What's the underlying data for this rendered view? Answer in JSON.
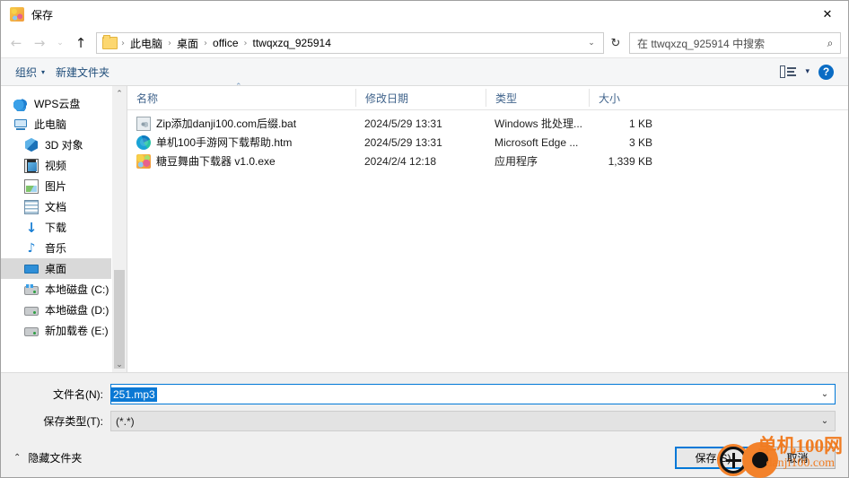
{
  "window": {
    "title": "保存",
    "icon": "app-icon",
    "close_label": "✕"
  },
  "nav": {
    "back": "←",
    "forward": "→",
    "history": "⌄",
    "up": "↑",
    "breadcrumbs": [
      "此电脑",
      "桌面",
      "office",
      "ttwqxzq_925914"
    ],
    "separator": "›",
    "dropdown": "⌄",
    "refresh": "↻",
    "search_placeholder": "在 ttwqxzq_925914 中搜索",
    "search_value": "",
    "search_icon": "⌕"
  },
  "command_bar": {
    "organize": "组织",
    "organize_caret": "▾",
    "new_folder": "新建文件夹",
    "view_caret": "▾",
    "help": "?"
  },
  "sidebar": {
    "scroll_up": "⌃",
    "scroll_down": "⌄",
    "items": [
      {
        "label": "WPS云盘",
        "icon": "cloud-icon",
        "indent": false,
        "selected": false
      },
      {
        "label": "此电脑",
        "icon": "pc-icon",
        "indent": false,
        "selected": false
      },
      {
        "label": "3D 对象",
        "icon": "3d-objects-icon",
        "indent": true,
        "selected": false
      },
      {
        "label": "视频",
        "icon": "video-icon",
        "indent": true,
        "selected": false
      },
      {
        "label": "图片",
        "icon": "pictures-icon",
        "indent": true,
        "selected": false
      },
      {
        "label": "文档",
        "icon": "documents-icon",
        "indent": true,
        "selected": false
      },
      {
        "label": "下载",
        "icon": "downloads-icon",
        "indent": true,
        "selected": false
      },
      {
        "label": "音乐",
        "icon": "music-icon",
        "indent": true,
        "selected": false
      },
      {
        "label": "桌面",
        "icon": "desktop-icon",
        "indent": true,
        "selected": true
      },
      {
        "label": "本地磁盘 (C:)",
        "icon": "system-drive-icon",
        "indent": true,
        "selected": false
      },
      {
        "label": "本地磁盘 (D:)",
        "icon": "drive-icon",
        "indent": true,
        "selected": false
      },
      {
        "label": "新加载卷 (E:)",
        "icon": "drive-icon",
        "indent": true,
        "selected": false
      }
    ]
  },
  "file_list": {
    "columns": {
      "name": "名称",
      "date": "修改日期",
      "type": "类型",
      "size": "大小"
    },
    "sort_indicator": "⌃",
    "rows": [
      {
        "name": "Zip添加danji100.com后缀.bat",
        "date": "2024/5/29 13:31",
        "type": "Windows 批处理...",
        "size": "1 KB",
        "icon": "bat-file-icon"
      },
      {
        "name": "单机100手游网下载帮助.htm",
        "date": "2024/5/29 13:31",
        "type": "Microsoft Edge ...",
        "size": "3 KB",
        "icon": "edge-html-file-icon"
      },
      {
        "name": "糖豆舞曲下载器 v1.0.exe",
        "date": "2024/2/4 12:18",
        "type": "应用程序",
        "size": "1,339 KB",
        "icon": "exe-file-icon"
      }
    ]
  },
  "form": {
    "filename_label": "文件名(N):",
    "filename_value": "251.mp3",
    "filename_caret": "⌄",
    "filetype_label": "保存类型(T):",
    "filetype_value": "(*.*)",
    "filetype_caret": "⌄"
  },
  "footer": {
    "hide_folders": "隐藏文件夹",
    "hide_folders_caret": "⌃",
    "save_button": "保存(S)",
    "cancel_button": "取消"
  },
  "watermark": {
    "line1": "单机100网",
    "line2": "danji100.com",
    "color": "#f07c22"
  },
  "colors": {
    "accent": "#0078d7",
    "selection": "#0a78d4",
    "column_header_text": "#41648c",
    "command_link": "#1f4d7a",
    "annotation": "#f3822b"
  }
}
